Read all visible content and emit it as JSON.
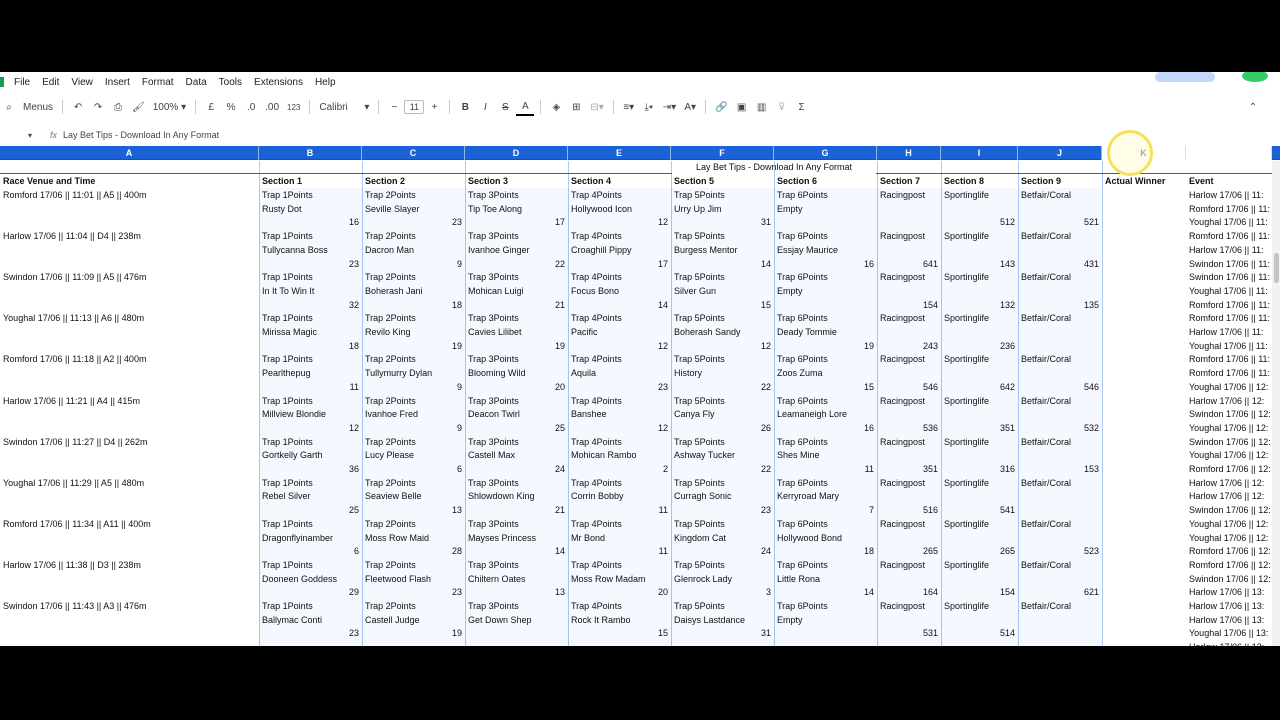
{
  "menu": [
    "File",
    "Edit",
    "View",
    "Insert",
    "Format",
    "Data",
    "Tools",
    "Extensions",
    "Help"
  ],
  "toolbar": {
    "menus_label": "Menus",
    "zoom": "100%",
    "currency": "£",
    "percent": "%",
    "dec_decrease": ".0",
    "dec_increase": ".00",
    "format_123": "123",
    "font": "Calibri",
    "font_size": "11",
    "bold": "B",
    "italic": "I",
    "underline_a": "A",
    "sum": "Σ"
  },
  "formula_bar": {
    "fx": "fx",
    "content": "Lay Bet Tips - Download In Any Format"
  },
  "columns": [
    "A",
    "B",
    "C",
    "D",
    "E",
    "F",
    "G",
    "H",
    "I",
    "J",
    "K",
    ""
  ],
  "sheet_title": "Lay Bet Tips - Download In Any Format",
  "headers": [
    "Race Venue and Time",
    "Section 1",
    "Section 2",
    "Section 3",
    "Section 4",
    "Section 5",
    "Section 6",
    "Section 7",
    "Section 8",
    "Section 9",
    "Actual Winner",
    "Event"
  ],
  "races": [
    {
      "venue": "Romford 17/06 || 11:01 || A5 || 400m",
      "dogs": [
        "Rusty Dot",
        "Seville Slayer",
        "Tip Toe Along",
        "Hollywood Icon",
        "Urry Up Jim",
        "Empty"
      ],
      "nums": [
        "16",
        "23",
        "17",
        "12",
        "31",
        "",
        "",
        "512",
        "521"
      ]
    },
    {
      "venue": "Harlow 17/06 || 11:04 || D4 || 238m",
      "dogs": [
        "Tullycanna Boss",
        "Dacron Man",
        "Ivanhoe Ginger",
        "Croaghill Pippy",
        "Burgess Mentor",
        "Essjay Maurice"
      ],
      "nums": [
        "23",
        "9",
        "22",
        "17",
        "14",
        "16",
        "641",
        "143",
        "431"
      ]
    },
    {
      "venue": "Swindon 17/06 || 11:09 || A5 || 476m",
      "dogs": [
        "In It To Win It",
        "Boherash Jani",
        "Mohican Luigi",
        "Focus Bono",
        "Silver Gun",
        "Empty"
      ],
      "nums": [
        "32",
        "18",
        "21",
        "14",
        "15",
        "",
        "154",
        "132",
        "135"
      ]
    },
    {
      "venue": "Youghal 17/06 || 11:13 || A6 || 480m",
      "dogs": [
        "Mirissa Magic",
        "Revilo King",
        "Cavies Lilibet",
        "Pacific",
        "Boherash Sandy",
        "Deady Tommie"
      ],
      "nums": [
        "18",
        "19",
        "19",
        "12",
        "12",
        "19",
        "243",
        "236",
        ""
      ]
    },
    {
      "venue": "Romford 17/06 || 11:18 || A2 || 400m",
      "dogs": [
        "Pearlthepug",
        "Tullymurry Dylan",
        "Blooming Wild",
        "Aquila",
        "History",
        "Zoos Zuma"
      ],
      "nums": [
        "11",
        "9",
        "20",
        "23",
        "22",
        "15",
        "546",
        "642",
        "546"
      ]
    },
    {
      "venue": "Harlow 17/06 || 11:21 || A4 || 415m",
      "dogs": [
        "Millview Blondie",
        "Ivanhoe Fred",
        "Deacon Twirl",
        "Banshee",
        "Canya Fly",
        "Leamaneigh Lore"
      ],
      "nums": [
        "12",
        "9",
        "25",
        "12",
        "26",
        "16",
        "536",
        "351",
        "532"
      ]
    },
    {
      "venue": "Swindon 17/06 || 11:27 || D4 || 262m",
      "dogs": [
        "Gortkelly Garth",
        "Lucy Please",
        "Castell Max",
        "Mohican Rambo",
        "Ashway Tucker",
        "Shes Mine"
      ],
      "nums": [
        "36",
        "6",
        "24",
        "2",
        "22",
        "11",
        "351",
        "316",
        "153"
      ]
    },
    {
      "venue": "Youghal 17/06 || 11:29 || A5 || 480m",
      "dogs": [
        "Rebel Silver",
        "Seaview Belle",
        "Shlowdown King",
        "Corrin Bobby",
        "Curragh Sonic",
        "Kerryroad Mary"
      ],
      "nums": [
        "25",
        "13",
        "21",
        "11",
        "23",
        "7",
        "516",
        "541",
        ""
      ]
    },
    {
      "venue": "Romford 17/06 || 11:34 || A11 || 400m",
      "dogs": [
        "Dragonflyinamber",
        "Moss Row Maid",
        "Mayses Princess",
        "Mr Bond",
        "Kingdom Cat",
        "Hollywood Bond"
      ],
      "nums": [
        "6",
        "28",
        "14",
        "11",
        "24",
        "18",
        "265",
        "265",
        "523"
      ]
    },
    {
      "venue": "Harlow 17/06 || 11:38 || D3 || 238m",
      "dogs": [
        "Dooneen Goddess",
        "Fleetwood Flash",
        "Chiltern Oates",
        "Moss Row Madam",
        "Glenrock Lady",
        "Little Rona"
      ],
      "nums": [
        "29",
        "23",
        "13",
        "20",
        "3",
        "14",
        "164",
        "154",
        "621"
      ]
    },
    {
      "venue": "Swindon 17/06 || 11:43 || A3 || 476m",
      "dogs": [
        "Ballymac Conti",
        "Castell Judge",
        "Get Down Shep",
        "Rock It Rambo",
        "Daisys Lastdance",
        "Empty"
      ],
      "nums": [
        "23",
        "19",
        "",
        "15",
        "31",
        "",
        "531",
        "514",
        ""
      ]
    }
  ],
  "traps": [
    "Trap 1Points",
    "Trap 2Points",
    "Trap 3Points",
    "Trap 4Points",
    "Trap 5Points",
    "Trap 6Points",
    "Racingpost",
    "Sportinglife",
    "Betfair/Coral"
  ],
  "events": [
    "Harlow 17/06 || 11:",
    "Romford 17/06 || 11:",
    "Youghal 17/06 || 11:",
    "Romford 17/06 || 11:",
    "Harlow 17/06 || 11:",
    "Swindon 17/06 || 11:",
    "Swindon 17/06 || 11:",
    "Youghal 17/06 || 11:",
    "Romford 17/06 || 11:",
    "Romford 17/06 || 11:",
    "Harlow 17/06 || 11:",
    "Youghal 17/06 || 11:",
    "Romford 17/06 || 11:",
    "Romford 17/06 || 11:",
    "Youghal 17/06 || 12:",
    "Harlow 17/06 || 12:",
    "Swindon 17/06 || 12:",
    "Youghal 17/06 || 12:",
    "Swindon 17/06 || 12:",
    "Youghal 17/06 || 12:",
    "Romford 17/06 || 12:",
    "Harlow 17/06 || 12:",
    "Harlow 17/06 || 12:",
    "Swindon 17/06 || 12:",
    "Youghal 17/06 || 12:",
    "Youghal 17/06 || 12:",
    "Romford 17/06 || 12:",
    "Romford 17/06 || 12:",
    "Swindon 17/06 || 12:",
    "Harlow 17/06 || 13:",
    "Harlow 17/06 || 13:",
    "Harlow 17/06 || 13:",
    "Youghal 17/06 || 13:",
    "Harlow 17/06 || 13:",
    "Harlow 17/06 || 13:"
  ],
  "colors": {
    "header_blue": "#1a62d6",
    "fill_blue": "#e8f0fe"
  }
}
